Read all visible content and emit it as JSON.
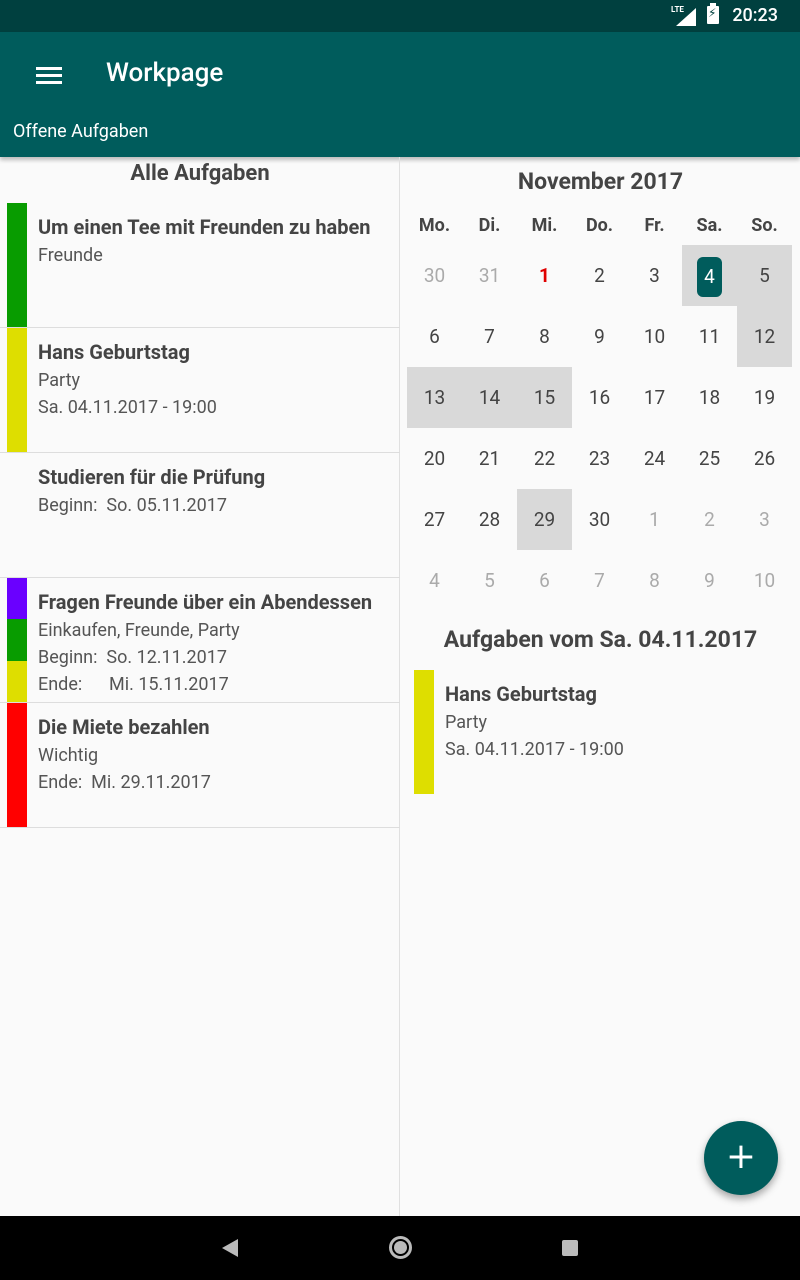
{
  "status_bar": {
    "network": "LTE",
    "time": "20:23"
  },
  "app_bar": {
    "title": "Workpage",
    "subtitle": "Offene Aufgaben"
  },
  "left": {
    "title": "Alle Aufgaben",
    "tasks": [
      {
        "title": "Um einen Tee mit Freunden zu haben",
        "lines": [
          "Freunde"
        ],
        "colors": [
          "#089c00"
        ]
      },
      {
        "title": "Hans Geburtstag",
        "lines": [
          "Party",
          "Sa. 04.11.2017 - 19:00"
        ],
        "colors": [
          "#dede00"
        ]
      },
      {
        "title": "Studieren für die Prüfung",
        "lines": [
          "Beginn:  So. 05.11.2017"
        ],
        "colors": []
      },
      {
        "title": "Fragen Freunde über ein Abendessen",
        "lines": [
          "Einkaufen, Freunde, Party",
          "Beginn:  So. 12.11.2017",
          "Ende:      Mi. 15.11.2017"
        ],
        "colors": [
          "#6a00ff",
          "#089c00",
          "#dede00"
        ]
      },
      {
        "title": "Die Miete bezahlen",
        "lines": [
          "Wichtig",
          "Ende:  Mi. 29.11.2017"
        ],
        "colors": [
          "#ff0000"
        ]
      }
    ]
  },
  "calendar": {
    "month_title": "November 2017",
    "weekdays": [
      "Mo.",
      "Di.",
      "Mi.",
      "Do.",
      "Fr.",
      "Sa.",
      "So."
    ],
    "weeks": [
      [
        "30",
        "31",
        "1",
        "2",
        "3",
        "4",
        "5"
      ],
      [
        "6",
        "7",
        "8",
        "9",
        "10",
        "11",
        "12"
      ],
      [
        "13",
        "14",
        "15",
        "16",
        "17",
        "18",
        "19"
      ],
      [
        "20",
        "21",
        "22",
        "23",
        "24",
        "25",
        "26"
      ],
      [
        "27",
        "28",
        "29",
        "30",
        "1",
        "2",
        "3"
      ],
      [
        "4",
        "5",
        "6",
        "7",
        "8",
        "9",
        "10"
      ]
    ],
    "muted": [
      [
        0,
        0
      ],
      [
        0,
        1
      ],
      [
        4,
        4
      ],
      [
        4,
        5
      ],
      [
        4,
        6
      ],
      [
        5,
        0
      ],
      [
        5,
        1
      ],
      [
        5,
        2
      ],
      [
        5,
        3
      ],
      [
        5,
        4
      ],
      [
        5,
        5
      ],
      [
        5,
        6
      ]
    ],
    "today": [
      0,
      2
    ],
    "selected": [
      0,
      5
    ],
    "shaded": [
      [
        0,
        5
      ],
      [
        0,
        6
      ],
      [
        1,
        6
      ],
      [
        2,
        0
      ],
      [
        2,
        1
      ],
      [
        2,
        2
      ],
      [
        4,
        2
      ]
    ],
    "today_color": "#e00000",
    "selected_color": "#005c5c",
    "shade_color": "#d9d9d9"
  },
  "day_tasks": {
    "title": "Aufgaben vom Sa. 04.11.2017",
    "tasks": [
      {
        "title": "Hans Geburtstag",
        "lines": [
          "Party",
          "Sa. 04.11.2017 - 19:00"
        ],
        "colors": [
          "#dede00"
        ]
      }
    ]
  },
  "fab": {
    "icon": "add-icon",
    "label": "+"
  },
  "nav": {
    "back": "back-icon",
    "home": "home-icon",
    "recent": "recent-apps-icon"
  }
}
